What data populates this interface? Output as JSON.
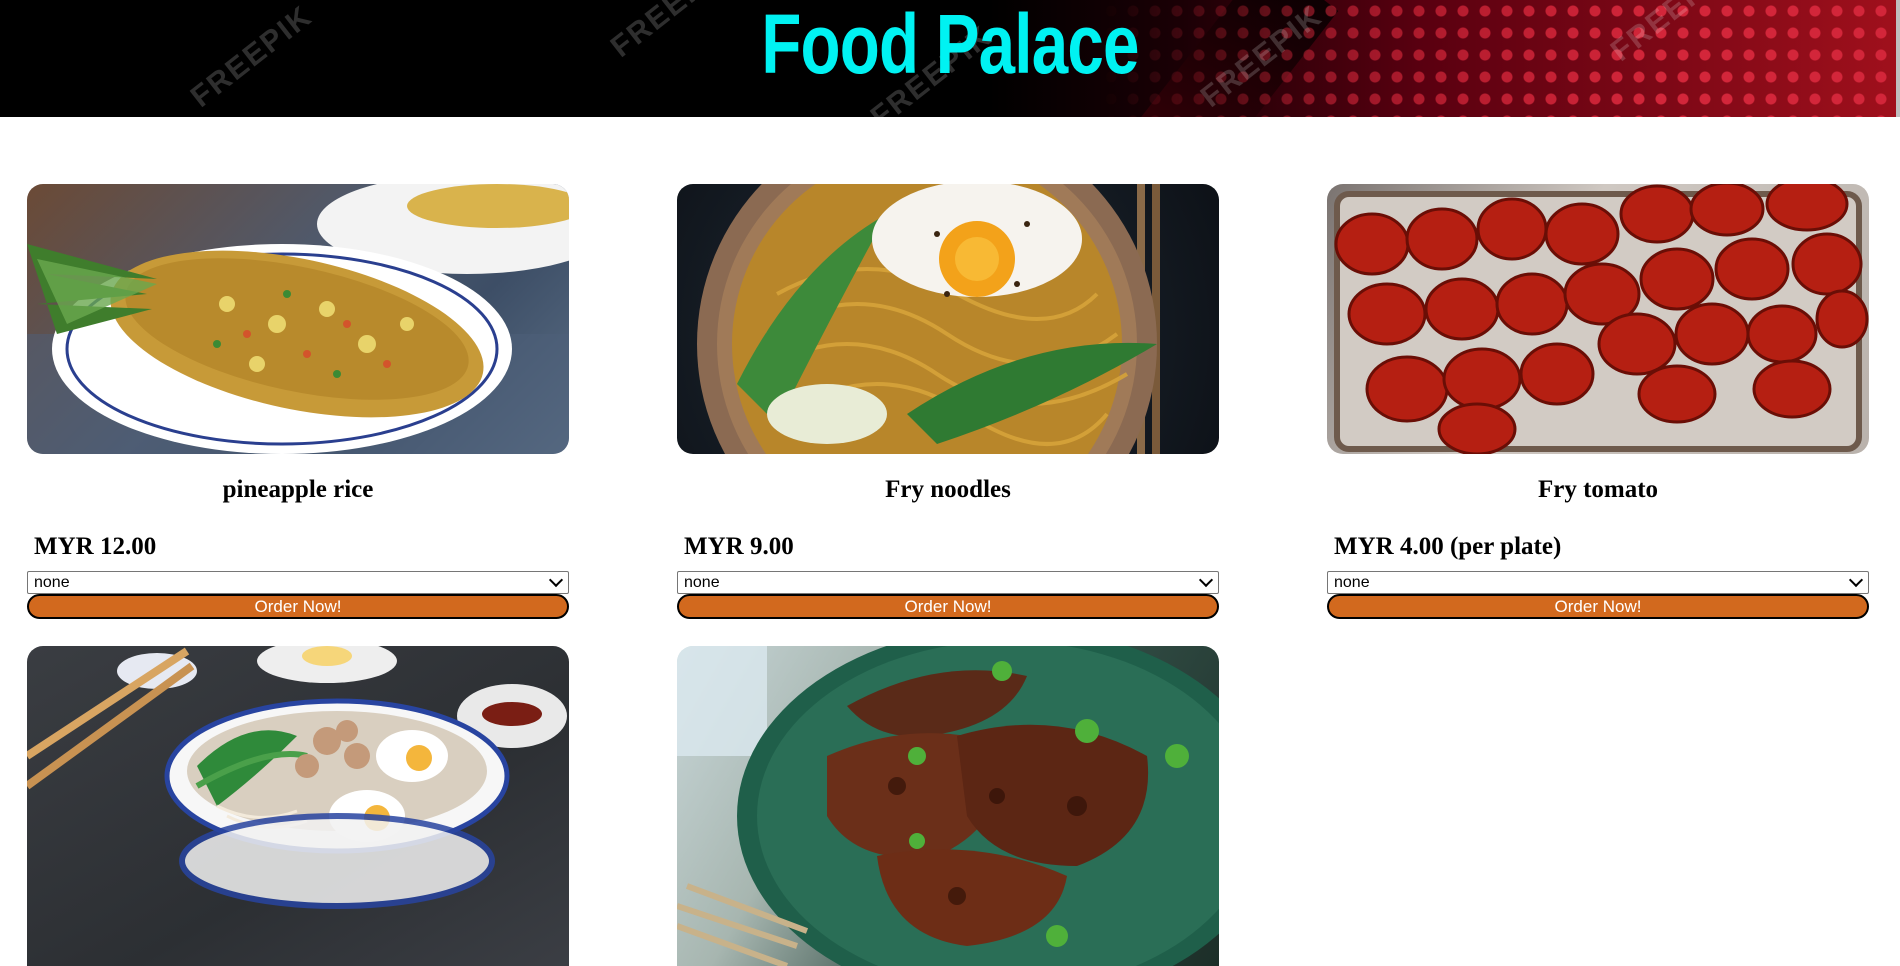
{
  "header": {
    "title": "Food Palace",
    "watermark": "FREEPIK"
  },
  "menu": {
    "items": [
      {
        "name": "pineapple rice",
        "price": "MYR 12.00",
        "quantity": "none",
        "order_label": "Order Now!",
        "image": "pineapple-rice-photo"
      },
      {
        "name": "Fry noodles",
        "price": "MYR 9.00",
        "quantity": "none",
        "order_label": "Order Now!",
        "image": "fry-noodles-photo"
      },
      {
        "name": "Fry tomato",
        "price": "MYR 4.00 (per plate)",
        "quantity": "none",
        "order_label": "Order Now!",
        "image": "fry-tomato-photo"
      },
      {
        "image": "noodle-soup-photo"
      },
      {
        "image": "grilled-chicken-photo"
      }
    ]
  },
  "colors": {
    "title": "#00f2f2",
    "order_button": "#d2691e",
    "header_background": "#000000",
    "header_accent": "#d3263a"
  }
}
